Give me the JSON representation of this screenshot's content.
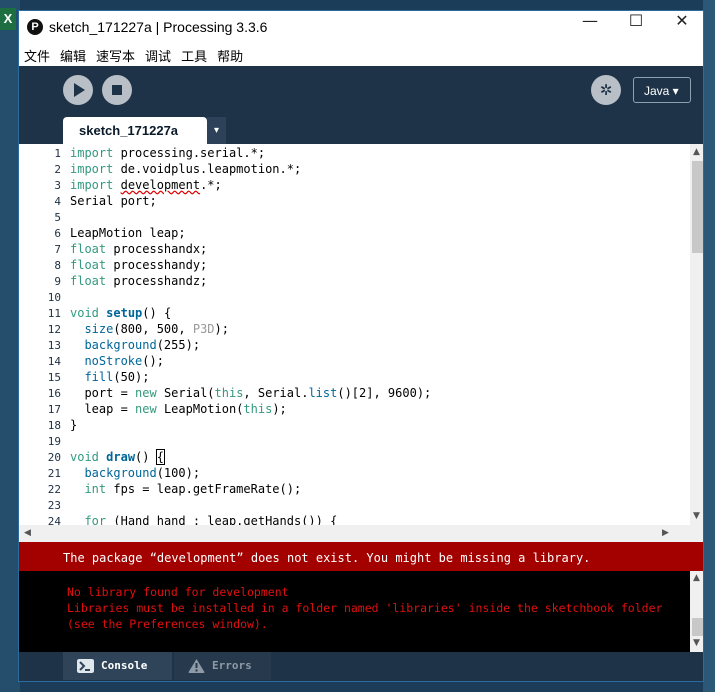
{
  "window": {
    "title": "sketch_171227a | Processing 3.3.6",
    "app_icon": "P",
    "controls": {
      "minimize": "—",
      "maximize": "☐",
      "close": "✕"
    }
  },
  "desktop": {
    "excel_label": "X"
  },
  "menu": [
    "文件",
    "编辑",
    "速写本",
    "调试",
    "工具",
    "帮助"
  ],
  "toolbar": {
    "run_icon": "play-icon",
    "stop_icon": "stop-icon",
    "debug_glyph": "✲",
    "mode": "Java ▾"
  },
  "tabs": {
    "active": "sketch_171227a",
    "menu_glyph": "▾"
  },
  "editor": {
    "line_numbers": [
      "1",
      "2",
      "3",
      "4",
      "5",
      "6",
      "7",
      "8",
      "9",
      "10",
      "11",
      "12",
      "13",
      "14",
      "15",
      "16",
      "17",
      "18",
      "19",
      "20",
      "21",
      "22",
      "23",
      "24"
    ]
  },
  "scroll": {
    "up": "▲",
    "down": "▼",
    "left": "◀",
    "right": "▶"
  },
  "error_message": "The package “development” does not exist. You might be missing a library.",
  "console": {
    "lines": [
      "No library found for development",
      "Libraries must be installed in a folder named 'libraries' inside the sketchbook folder",
      "(see the Preferences window)."
    ]
  },
  "footer": {
    "console_label": "Console",
    "errors_label": "Errors"
  }
}
